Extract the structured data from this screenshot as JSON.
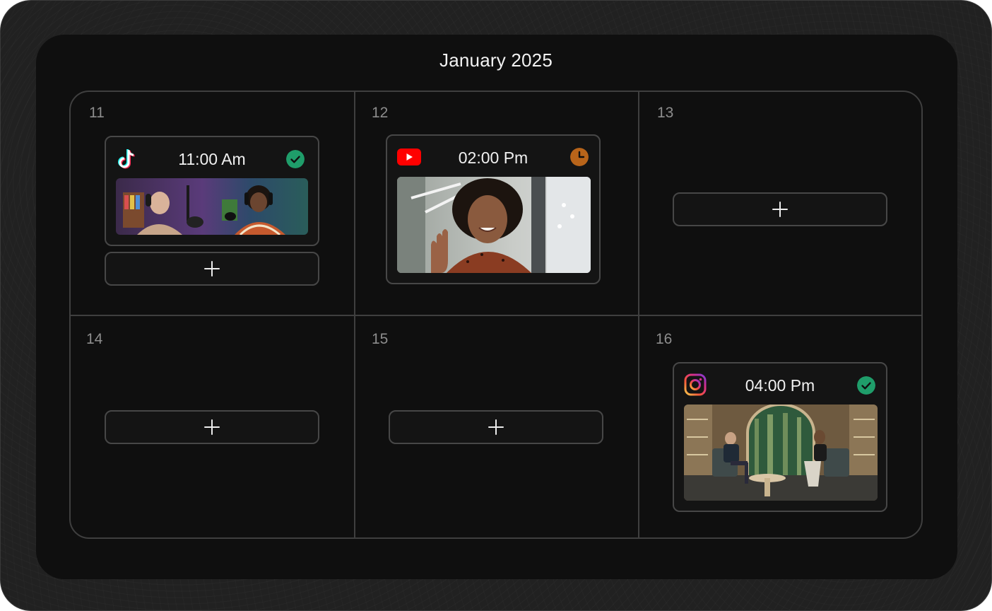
{
  "calendar": {
    "title": "January 2025",
    "days": [
      {
        "day": "11",
        "post": {
          "platform": "tiktok",
          "time": "11:00 Am",
          "status": "published"
        },
        "add_label": "+"
      },
      {
        "day": "12",
        "post": {
          "platform": "youtube",
          "time": "02:00 Pm",
          "status": "scheduled"
        }
      },
      {
        "day": "13",
        "add_label": "+"
      },
      {
        "day": "14",
        "add_label": "+"
      },
      {
        "day": "15",
        "add_label": "+"
      },
      {
        "day": "16",
        "post": {
          "platform": "instagram",
          "time": "04:00 Pm",
          "status": "published"
        }
      }
    ]
  },
  "icons": {
    "tiktok": "tiktok-icon",
    "youtube": "youtube-icon",
    "instagram": "instagram-icon",
    "published": "check-circle-icon",
    "scheduled": "clock-icon",
    "add": "plus-icon"
  },
  "colors": {
    "published": "#1f9d6a",
    "scheduled": "#b8641a",
    "youtube": "#ff0000"
  }
}
